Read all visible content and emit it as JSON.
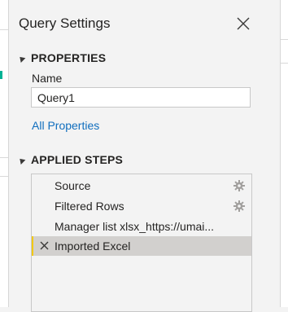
{
  "pane": {
    "title": "Query Settings"
  },
  "properties": {
    "heading": "PROPERTIES",
    "name_label": "Name",
    "name_value": "Query1",
    "all_properties_link": "All Properties"
  },
  "applied_steps": {
    "heading": "APPLIED STEPS",
    "steps": [
      {
        "label": "Source",
        "has_settings": true
      },
      {
        "label": "Filtered Rows",
        "has_settings": true
      },
      {
        "label": "Manager list xlsx_https://umai...",
        "has_settings": false
      },
      {
        "label": "Imported Excel",
        "has_settings": false,
        "selected": true
      }
    ]
  },
  "colors": {
    "accent_link": "#106ebe",
    "selected_step_bg": "#d2d0ce",
    "selected_step_marker": "#f2c811"
  },
  "icons": {
    "close": "close-icon",
    "collapse": "collapse-triangle-icon",
    "step_settings": "gear-icon",
    "delete_step": "delete-step-x-icon"
  }
}
